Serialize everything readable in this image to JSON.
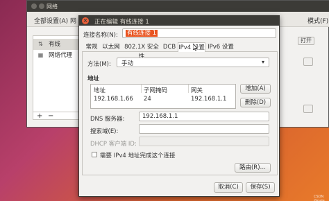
{
  "background_window": {
    "title": "网络",
    "menu": [
      "全部设置(A)",
      "网"
    ],
    "right_menu_tail": "模式(F)",
    "sidebar": [
      {
        "label": "有线",
        "icon": "wired-network-icon",
        "selected": true
      },
      {
        "label": "网络代理",
        "icon": "network-proxy-icon",
        "selected": false
      }
    ],
    "toggle_label": "打开",
    "add_symbol": "+",
    "remove_symbol": "−"
  },
  "dialog": {
    "title": "正在编辑 有线连接 1",
    "connection_name_label": "连接名称(N):",
    "connection_name_value": "有线连接 1",
    "tabs": [
      "常规",
      "以太网",
      "802.1X 安全性",
      "DCB",
      "IPv4 设置",
      "IPv6 设置"
    ],
    "active_tab": "IPv4 设置",
    "method_label": "方法(M):",
    "method_value": "手动",
    "address_section_label": "地址",
    "address_columns": [
      "地址",
      "子网掩码",
      "网关"
    ],
    "address_rows": [
      {
        "address": "192.168.1.66",
        "netmask": "24",
        "gateway": "192.168.1.1"
      }
    ],
    "add_button": "增加(A)",
    "delete_button": "删除(D)",
    "dns_label": "DNS 服务器:",
    "dns_value": "192.168.1.1",
    "search_domain_label": "搜索域(E):",
    "search_domain_value": "",
    "dhcp_client_id_label": "DHCP 客户端 ID:",
    "dhcp_client_id_value": "",
    "require_ipv4_label": "需要 IPv4 地址完成这个连接",
    "require_ipv4_checked": false,
    "routes_button": "路由(R)…",
    "cancel_button": "取消(C)",
    "save_button": "保存(S)"
  },
  "watermark": "CSDN @pale",
  "colors": {
    "title_bar": "#3c3b37",
    "close_button": "#ea5f38",
    "selection_highlight": "#e95420",
    "desktop_gradient_start": "#8a2a52",
    "desktop_gradient_end": "#e87a2a"
  }
}
